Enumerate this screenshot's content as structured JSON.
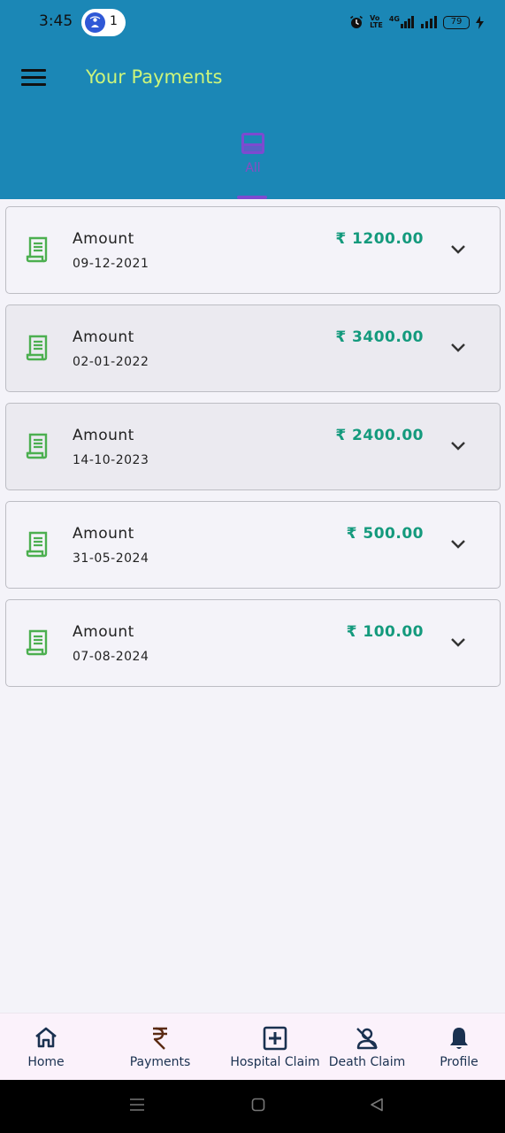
{
  "status_bar": {
    "time": "3:45",
    "hotspot_count": "1",
    "network_label_top": "Vo",
    "network_label_bottom": "LTE",
    "network_type": "4G",
    "battery_level": "79"
  },
  "app_bar": {
    "title": "Your Payments"
  },
  "tabs": [
    {
      "label": "All",
      "selected": true
    }
  ],
  "payments": [
    {
      "label": "Amount",
      "date": "09-12-2021",
      "amount": "₹ 1200.00"
    },
    {
      "label": "Amount",
      "date": "02-01-2022",
      "amount": "₹ 3400.00"
    },
    {
      "label": "Amount",
      "date": "14-10-2023",
      "amount": "₹ 2400.00"
    },
    {
      "label": "Amount",
      "date": "31-05-2024",
      "amount": "₹ 500.00"
    },
    {
      "label": "Amount",
      "date": "07-08-2024",
      "amount": "₹ 100.00"
    }
  ],
  "bottom_nav": [
    {
      "label": "Home",
      "icon": "home-icon"
    },
    {
      "label": "Payments",
      "icon": "rupee-icon"
    },
    {
      "label": "Hospital Claim",
      "icon": "hospital-plus-icon"
    },
    {
      "label": "Death Claim",
      "icon": "person-off-icon"
    },
    {
      "label": "Profile",
      "icon": "bell-icon"
    }
  ],
  "colors": {
    "app_bar": "#1b87b6",
    "title": "#cdf57b",
    "amount": "#149a7d",
    "receipt_icon": "#4caf50",
    "tab_accent": "#7d4ad0",
    "nav_text": "#1a3150"
  }
}
